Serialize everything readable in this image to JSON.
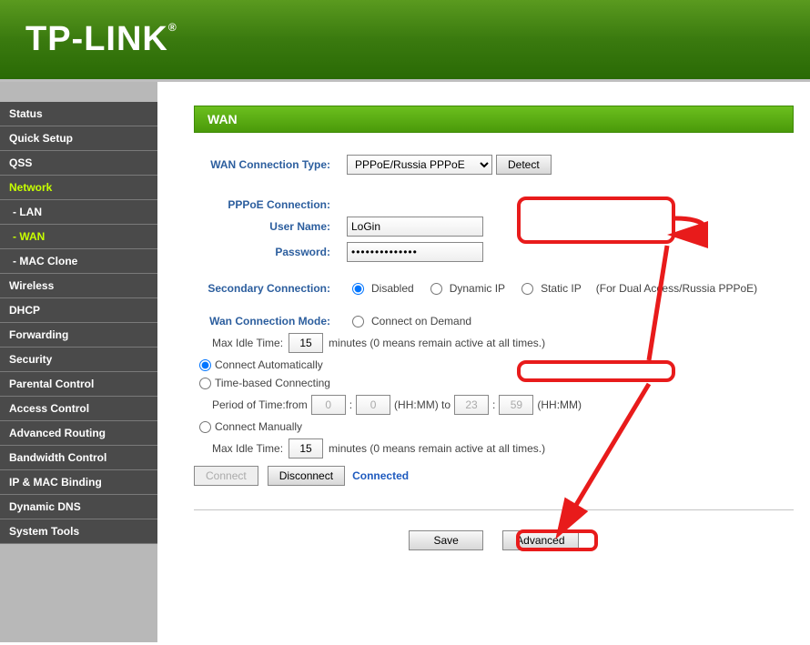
{
  "brand": "TP-LINK",
  "sidebar": {
    "items": [
      {
        "label": "Status"
      },
      {
        "label": "Quick Setup"
      },
      {
        "label": "QSS"
      },
      {
        "label": "Network"
      },
      {
        "label": "- LAN"
      },
      {
        "label": "- WAN"
      },
      {
        "label": "- MAC Clone"
      },
      {
        "label": "Wireless"
      },
      {
        "label": "DHCP"
      },
      {
        "label": "Forwarding"
      },
      {
        "label": "Security"
      },
      {
        "label": "Parental Control"
      },
      {
        "label": "Access Control"
      },
      {
        "label": "Advanced Routing"
      },
      {
        "label": "Bandwidth Control"
      },
      {
        "label": "IP & MAC Binding"
      },
      {
        "label": "Dynamic DNS"
      },
      {
        "label": "System Tools"
      }
    ]
  },
  "panel": {
    "title": "WAN"
  },
  "labels": {
    "wan_type": "WAN Connection Type:",
    "pppoe_conn": "PPPoE Connection:",
    "username": "User Name:",
    "password": "Password:",
    "secondary": "Secondary Connection:",
    "wan_mode": "Wan Connection Mode:"
  },
  "fields": {
    "wan_type_value": "PPPoE/Russia PPPoE",
    "detect_btn": "Detect",
    "username_value": "LoGin",
    "password_value": "••••••••••••••",
    "sec_disabled": "Disabled",
    "sec_dynamic": "Dynamic IP",
    "sec_static": "Static IP",
    "sec_note": "(For Dual Access/Russia PPPoE)",
    "mode_connect_demand": "Connect on Demand",
    "mode_max_idle": "Max Idle Time:",
    "mode_max_idle_val1": "15",
    "mode_minutes_note": "minutes (0 means remain active at all times.)",
    "mode_connect_auto": "Connect Automatically",
    "mode_time_based": "Time-based Connecting",
    "mode_period": "Period of Time:from",
    "mode_p1": "0",
    "mode_p2": "0",
    "mode_hhmm": "(HH:MM) to",
    "mode_p3": "23",
    "mode_p4": "59",
    "mode_hhmm2": "(HH:MM)",
    "mode_connect_manual": "Connect Manually",
    "mode_max_idle_val2": "15",
    "connect_btn": "Connect",
    "disconnect_btn": "Disconnect",
    "connected": "Connected",
    "save_btn": "Save",
    "advanced_btn": "Advanced"
  }
}
